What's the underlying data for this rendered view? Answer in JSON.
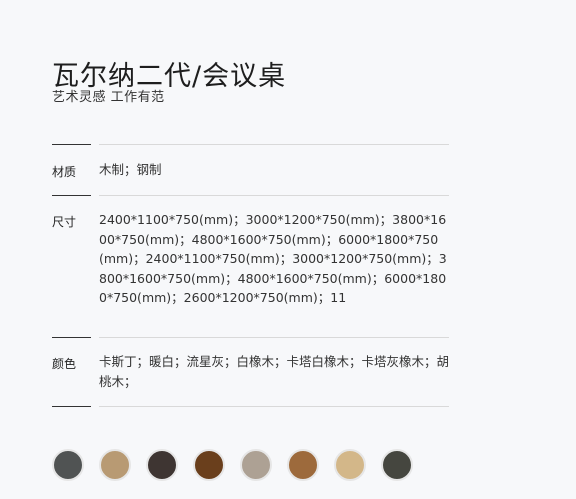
{
  "product": {
    "title": "瓦尔纳二代/会议桌",
    "subtitle": "艺术灵感 工作有范"
  },
  "specs": [
    {
      "label": "材质",
      "value": "木制；钢制"
    },
    {
      "label": "尺寸",
      "value": "2400*1100*750(mm)；3000*1200*750(mm)；3800*1600*750(mm)；4800*1600*750(mm)；6000*1800*750(mm)；2400*1100*750(mm)；3000*1200*750(mm)；3800*1600*750(mm)；4800*1600*750(mm)；6000*1800*750(mm)；2600*1200*750(mm)；11"
    },
    {
      "label": "颜色",
      "value": "卡斯丁；暖白；流星灰；白橡木；卡塔白橡木；卡塔灰橡木；胡桃木；"
    }
  ],
  "swatches": [
    {
      "name": "dark-gray",
      "color": "#505353"
    },
    {
      "name": "light-oak",
      "color": "#b89a73"
    },
    {
      "name": "dark-brown",
      "color": "#3e3532"
    },
    {
      "name": "walnut",
      "color": "#6a3f1c"
    },
    {
      "name": "gray-oak",
      "color": "#ada194"
    },
    {
      "name": "teak",
      "color": "#9d6a3c"
    },
    {
      "name": "light-beige",
      "color": "#d3b789"
    },
    {
      "name": "charcoal",
      "color": "#45463f"
    }
  ]
}
